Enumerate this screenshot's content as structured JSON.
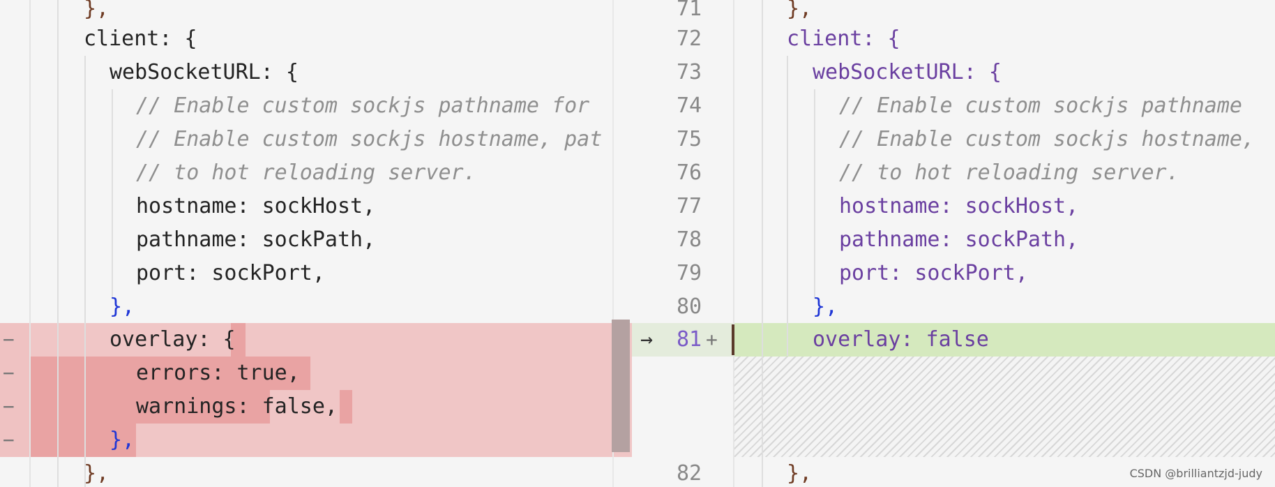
{
  "left": {
    "lines": [
      {
        "marker": "",
        "code": "},"
      },
      {
        "marker": "",
        "code": "client: {"
      },
      {
        "marker": "",
        "code": "webSocketURL: {"
      },
      {
        "marker": "",
        "code": "// Enable custom sockjs pathname for"
      },
      {
        "marker": "",
        "code": "// Enable custom sockjs hostname, pat"
      },
      {
        "marker": "",
        "code": "// to hot reloading server."
      },
      {
        "marker": "",
        "code": "hostname: sockHost,"
      },
      {
        "marker": "",
        "code": "pathname: sockPath,"
      },
      {
        "marker": "",
        "code": "port: sockPort,"
      },
      {
        "marker": "",
        "code": "},"
      },
      {
        "marker": "−",
        "code": "overlay: {"
      },
      {
        "marker": "−",
        "code": "errors: true,"
      },
      {
        "marker": "−",
        "code": "warnings: false,"
      },
      {
        "marker": "−",
        "code": "},"
      },
      {
        "marker": "",
        "code": "},"
      }
    ]
  },
  "right": {
    "lines": [
      {
        "num": "71",
        "code": "},"
      },
      {
        "num": "72",
        "code": "client: {"
      },
      {
        "num": "73",
        "code": "webSocketURL: {"
      },
      {
        "num": "74",
        "code": "// Enable custom sockjs pathname"
      },
      {
        "num": "75",
        "code": "// Enable custom sockjs hostname,"
      },
      {
        "num": "76",
        "code": "// to hot reloading server."
      },
      {
        "num": "77",
        "code": "hostname: sockHost,"
      },
      {
        "num": "78",
        "code": "pathname: sockPath,"
      },
      {
        "num": "79",
        "code": "port: sockPort,"
      },
      {
        "num": "80",
        "code": "},"
      },
      {
        "num": "81",
        "marker": "+",
        "arrow": "→",
        "code": "overlay: false"
      },
      {
        "num": "82",
        "code": "},"
      }
    ]
  },
  "watermark": "CSDN @brilliantzjd-judy",
  "colors": {
    "removed_bg": "#f0c6c6",
    "removed_char_bg": "#e9a3a3",
    "added_bg": "#d5e9be",
    "brace_blue": "#1f36d6",
    "brace_brown": "#6f3b23",
    "identifier_purple": "#6a3fa0",
    "literal_brown": "#8a5a2b",
    "comment_gray": "#8f8f8f"
  }
}
